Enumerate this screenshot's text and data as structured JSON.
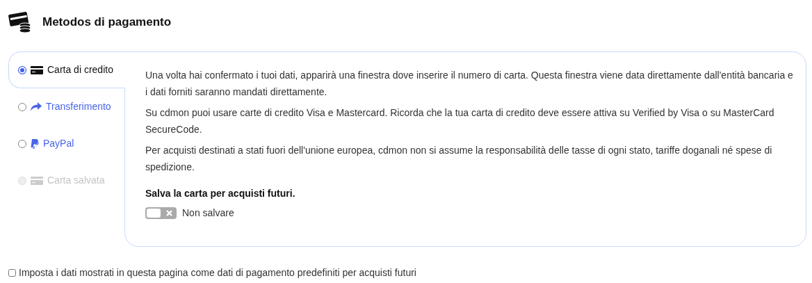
{
  "title": "Metodos di pagamento",
  "methods": [
    {
      "label": "Carta di credito",
      "kind": "card",
      "selected": true,
      "disabled": false
    },
    {
      "label": "Transferimento",
      "kind": "transfer",
      "selected": false,
      "disabled": false
    },
    {
      "label": "PayPal",
      "kind": "paypal",
      "selected": false,
      "disabled": false
    },
    {
      "label": "Carta salvata",
      "kind": "card",
      "selected": false,
      "disabled": true
    }
  ],
  "paragraphs": [
    "Una volta hai confermato i tuoi dati, apparirà una finestra dove inserire il numero di carta. Questa finestra viene data direttamente dall'entità bancaria e i dati forniti saranno mandati direttamente.",
    "Su cdmon puoi usare carte di credito Visa e Mastercard. Ricorda che la tua carta di credito deve essere attiva su Verified by Visa o su MasterCard SecureCode.",
    "Per acquisti destinati a stati fuori dell'unione europea, cdmon non si assume la responsabilità delle tasse di ogni stato, tariffe doganali né spese di spedizione."
  ],
  "save_card": {
    "heading": "Salva la carta per acquisti futuri.",
    "on": false,
    "label": "Non salvare"
  },
  "default_option": {
    "label": "Imposta i dati mostrati in questa pagina come dati di pagamento predefiniti per acquisti futuri",
    "checked": false
  }
}
